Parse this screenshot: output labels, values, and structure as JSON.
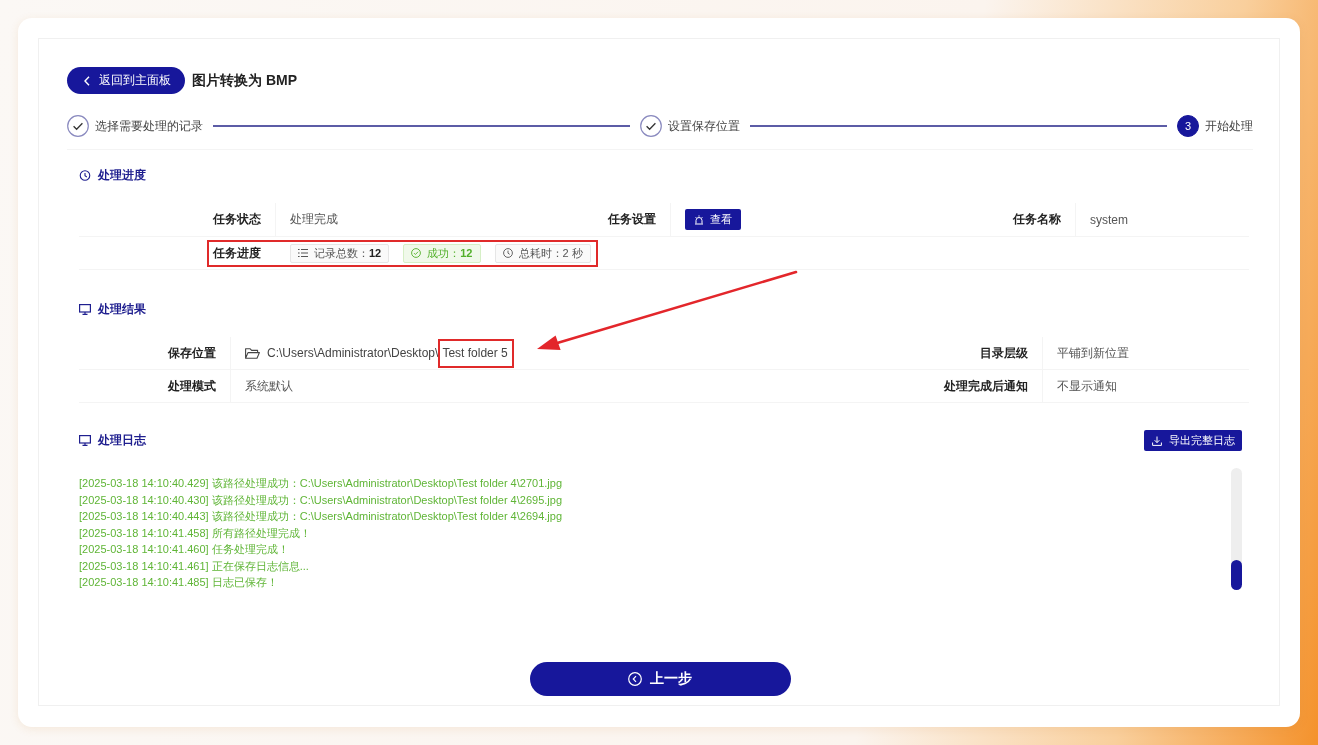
{
  "header": {
    "back_button": "返回到主面板",
    "title": "图片转换为 BMP"
  },
  "steps": [
    {
      "label": "选择需要处理的记录",
      "done": true,
      "selected": false
    },
    {
      "label": "设置保存位置",
      "done": true,
      "selected": false
    },
    {
      "number": "3",
      "label": "开始处理",
      "done": false,
      "selected": true
    }
  ],
  "progress_section": {
    "title": "处理进度",
    "fields": [
      {
        "label": "任务状态",
        "kind": "text",
        "value": "处理完成"
      },
      {
        "label": "任务设置",
        "kind": "button",
        "value": "查看"
      },
      {
        "label": "任务名称",
        "kind": "text",
        "value": "system"
      }
    ],
    "progress_row": {
      "label": "任务进度",
      "highlighted": true,
      "tags": [
        {
          "kind": "total",
          "text": "记录总数：**12**"
        },
        {
          "kind": "success",
          "text": "成功：**12**"
        },
        {
          "kind": "time",
          "text": "总耗时：2 秒"
        }
      ]
    }
  },
  "result_section": {
    "title": "处理结果",
    "fields": [
      {
        "label": "保存位置",
        "kind": "path",
        "parts": [
          {
            "text": "C:\\Users\\Administrator\\Desktop\\",
            "highlighted": false
          },
          {
            "text": "Test folder 5",
            "highlighted": true
          }
        ]
      },
      {
        "label": "目录层级",
        "kind": "text",
        "value": "平铺到新位置"
      },
      {
        "label": "处理模式",
        "kind": "text",
        "value": "系统默认"
      },
      {
        "label": "处理完成后通知",
        "kind": "text",
        "value": "不显示通知"
      }
    ]
  },
  "log_section": {
    "title": "处理日志",
    "export_button": "导出完整日志",
    "lines": [
      "[2025-03-18 14:10:40.429] 该路径处理成功：C:\\Users\\Administrator\\Desktop\\Test folder 4\\2701.jpg",
      "[2025-03-18 14:10:40.430] 该路径处理成功：C:\\Users\\Administrator\\Desktop\\Test folder 4\\2695.jpg",
      "[2025-03-18 14:10:40.443] 该路径处理成功：C:\\Users\\Administrator\\Desktop\\Test folder 4\\2694.jpg",
      "[2025-03-18 14:10:41.458] 所有路径处理完成！",
      "[2025-03-18 14:10:41.460] 任务处理完成！",
      "[2025-03-18 14:10:41.461] 正在保存日志信息...",
      "[2025-03-18 14:10:41.485] 日志已保存！"
    ]
  },
  "back_step_button": "上一步",
  "annotations": {
    "arrow": true
  }
}
